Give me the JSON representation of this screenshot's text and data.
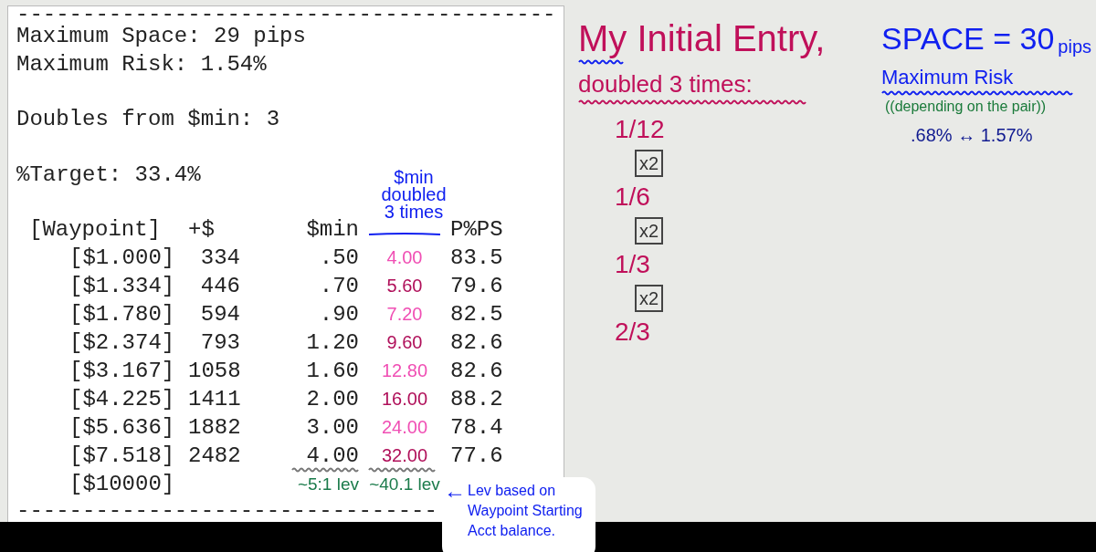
{
  "console": {
    "separator_top": "-----------------------------------------",
    "lines": [
      {
        "kind": "text",
        "text": "Maximum Space: 29 pips"
      },
      {
        "kind": "text",
        "text": "Maximum Risk: 1.54%"
      },
      {
        "kind": "blank"
      },
      {
        "kind": "text",
        "text": "Doubles from $min: 3"
      },
      {
        "kind": "blank"
      },
      {
        "kind": "text",
        "text": "%Target: 33.4%"
      },
      {
        "kind": "blank"
      }
    ],
    "table": {
      "columns": [
        "[Waypoint]",
        "+$",
        "$min",
        "P%PS"
      ],
      "doubled_header": "$min doubled 3 times",
      "rows": [
        {
          "waypoint": "[$1.000]",
          "plus": "334",
          "min": ".50",
          "doubled": "4.00",
          "color": "#f04fb4",
          "ppps": "83.5",
          "underlined": false
        },
        {
          "waypoint": "[$1.334]",
          "plus": "446",
          "min": ".70",
          "doubled": "5.60",
          "color": "#b0105a",
          "ppps": "79.6",
          "underlined": false
        },
        {
          "waypoint": "[$1.780]",
          "plus": "594",
          "min": ".90",
          "doubled": "7.20",
          "color": "#f04fb4",
          "ppps": "82.5",
          "underlined": false
        },
        {
          "waypoint": "[$2.374]",
          "plus": "793",
          "min": "1.20",
          "doubled": "9.60",
          "color": "#b0105a",
          "ppps": "82.6",
          "underlined": false
        },
        {
          "waypoint": "[$3.167]",
          "plus": "1058",
          "min": "1.60",
          "doubled": "12.80",
          "color": "#f04fb4",
          "ppps": "82.6",
          "underlined": false
        },
        {
          "waypoint": "[$4.225]",
          "plus": "1411",
          "min": "2.00",
          "doubled": "16.00",
          "color": "#b0105a",
          "ppps": "88.2",
          "underlined": false
        },
        {
          "waypoint": "[$5.636]",
          "plus": "1882",
          "min": "3.00",
          "doubled": "24.00",
          "color": "#f04fb4",
          "ppps": "78.4",
          "underlined": false
        },
        {
          "waypoint": "[$7.518]",
          "plus": "2482",
          "min": "4.00",
          "doubled": "32.00",
          "color": "#b0105a",
          "ppps": "77.6",
          "underlined": true
        }
      ],
      "last_row": {
        "waypoint": "[$10000]",
        "leverage_notes": [
          "~5:1 lev",
          "~40.1 lev"
        ]
      }
    },
    "separator_bottom": "--------------------------------"
  },
  "callout": {
    "arrow": "←",
    "note": "Lev based on Waypoint Starting Acct balance."
  },
  "entry_notes": {
    "title": "My Initial Entry,",
    "subtitle": "doubled 3 times:",
    "steps": [
      {
        "kind": "fraction",
        "text": "1/12"
      },
      {
        "kind": "multiplier",
        "text": "x2"
      },
      {
        "kind": "fraction",
        "text": "1/6"
      },
      {
        "kind": "multiplier",
        "text": "x2"
      },
      {
        "kind": "fraction",
        "text": "1/3"
      },
      {
        "kind": "multiplier",
        "text": "x2"
      },
      {
        "kind": "fraction",
        "text": "2/3"
      }
    ]
  },
  "space_notes": {
    "title": "SPACE = 30",
    "unit": "pips",
    "subtitle": "Maximum Risk",
    "qualifier": "((depending on the pair))",
    "range": ".68% ↔ 1.57%"
  }
}
